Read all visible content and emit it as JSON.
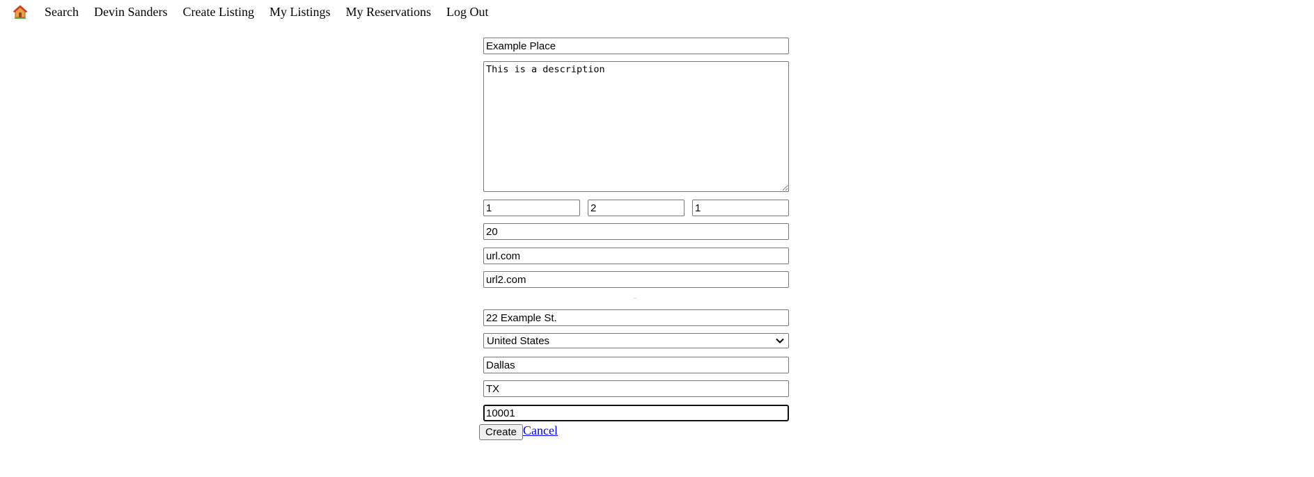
{
  "nav": {
    "home_icon": "house-icon",
    "items": [
      {
        "label": "Search"
      },
      {
        "label": "Devin Sanders"
      },
      {
        "label": "Create Listing"
      },
      {
        "label": "My Listings"
      },
      {
        "label": "My Reservations"
      },
      {
        "label": "Log Out"
      }
    ]
  },
  "form": {
    "title_value": "Example Place",
    "description_value": "This is a description",
    "num_a_value": "1",
    "num_b_value": "2",
    "num_c_value": "1",
    "price_value": "20",
    "url1_value": "url.com",
    "url2_value": "url2.com",
    "street_value": "22 Example St.",
    "country_value": "United States",
    "country_chevron_icon": "chevron-down-icon",
    "city_value": "Dallas",
    "state_value": "TX",
    "zip_value": "10001",
    "create_label": "Create",
    "cancel_label": "Cancel"
  },
  "colors": {
    "link": "#0000ee",
    "button_bg": "#efefef",
    "border": "#767676"
  }
}
